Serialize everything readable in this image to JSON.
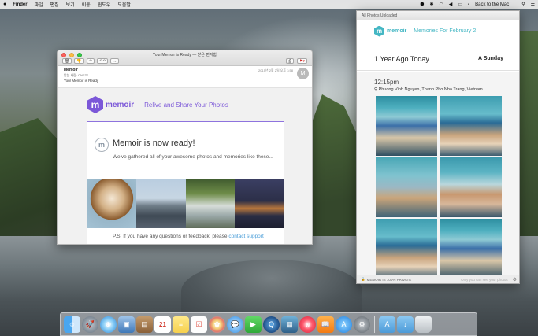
{
  "menubar": {
    "apple": "",
    "items": [
      "Finder",
      "파일",
      "편집",
      "보기",
      "이동",
      "윈도우",
      "도움말"
    ],
    "right_label": "Back to the Mac"
  },
  "mail": {
    "title": "Your Memoir is Ready — 받은 편지함",
    "from": "Memoir",
    "to": "받는 사람:  ONE™",
    "subject": "Your Memoir is Ready",
    "date": "2015년 2월 2일 오후 3:58",
    "avatar": "M",
    "brand_logo": "m",
    "brand_name": "memoir",
    "brand_tagline": "Relive and Share Your Photos",
    "card_icon": "m",
    "card_title": "Memoir is now ready!",
    "card_text": "We've gathered all of your awesome photos and memories like these...",
    "ps_text": "P.S. If you have any questions or feedback, please",
    "ps_link": "contact support"
  },
  "photos": {
    "window_title": "All Photos Uploaded",
    "brand_logo": "m",
    "brand_name": "memoir",
    "tagline": "Memories For February 2",
    "section_title": "1 Year Ago Today",
    "section_day": "A Sunday",
    "time": "12:15pm",
    "location": "Phuong Vinh Nguyen, Thanh Pho Nha Trang, Vietnam",
    "footer_left": "MEMOIR IS 100% PRIVATE",
    "footer_right": "Only you can see your photos"
  },
  "dock": {
    "calendar_day": "21"
  },
  "colors": {
    "memoir_purple": "#7b57d8",
    "memoir_teal": "#45b7c4",
    "link_blue": "#4b9ed8"
  }
}
